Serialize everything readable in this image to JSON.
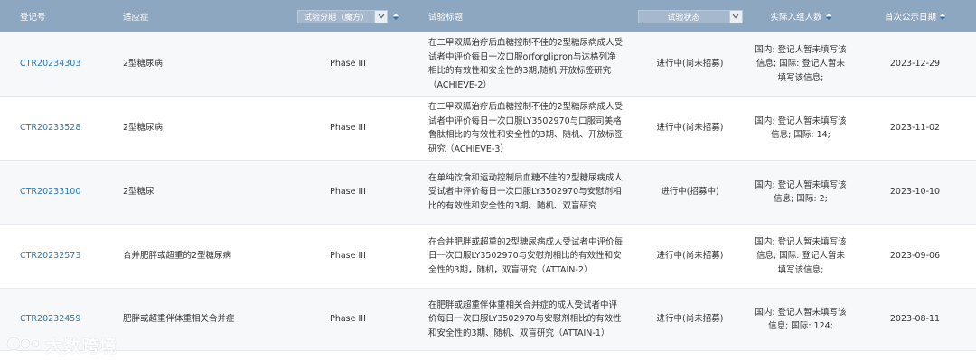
{
  "header": {
    "reg_no": "登记号",
    "indication": "适应症",
    "phase_select": "试验分期（魔方）",
    "title": "试验标题",
    "status_select": "试验状态",
    "enrolled": "实际入组人数",
    "first_pub_date": "首次公示日期"
  },
  "rows": [
    {
      "reg_no": "CTR20234303",
      "indication": "2型糖尿病",
      "phase": "Phase III",
      "title": "在二甲双胍治疗后血糖控制不佳的2型糖尿病成人受试者中评价每日一次口服orforglipron与达格列净相比的有效性和安全性的3期,随机,开放标签研究（ACHIEVE-2）",
      "status": "进行中(尚未招募)",
      "enrolled": "国内: 登记人暂未填写该信息; 国际: 登记人暂未填写该信息;",
      "date": "2023-12-29"
    },
    {
      "reg_no": "CTR20233528",
      "indication": "2型糖尿病",
      "phase": "Phase III",
      "title": "在二甲双胍治疗后血糖控制不佳的2型糖尿病成人受试者中评价每日一次口服LY3502970与口服司美格鲁肽相比的有效性和安全性的3期、随机、开放标签研究（ACHIEVE-3）",
      "status": "进行中(尚未招募)",
      "enrolled": "国内: 登记人暂未填写该信息; 国际: 14;",
      "date": "2023-11-02"
    },
    {
      "reg_no": "CTR20233100",
      "indication": "2型糖尿",
      "phase": "Phase III",
      "title": "在单纯饮食和运动控制后血糖不佳的2型糖尿病成人受试者中评价每日一次口服LY3502970与安慰剂相比的有效性和安全性的3期、随机、双盲研究",
      "status": "进行中(招募中)",
      "enrolled": "国内: 登记人暂未填写该信息; 国际: 2;",
      "date": "2023-10-10"
    },
    {
      "reg_no": "CTR20232573",
      "indication": "合并肥胖或超重的2型糖尿病",
      "phase": "Phase III",
      "title": "在合并肥胖或超重的2型糖尿病成人受试者中评价每日一次口服LY3502970与安慰剂相比的有效性和安全性的3期，随机，双盲研究（ATTAIN-2）",
      "status": "进行中(尚未招募)",
      "enrolled": "国内: 登记人暂未填写该信息; 国际: 登记人暂未填写该信息;",
      "date": "2023-09-06"
    },
    {
      "reg_no": "CTR20232459",
      "indication": "肥胖或超重伴体重相关合并症",
      "phase": "Phase III",
      "title": "在肥胖或超重伴体重相关合并症的成人受试者中评价每日一次口服LY3502970与安慰剂相比的有效性和安全性的3期、随机、双盲研究（ATTAIN-1）",
      "status": "进行中(尚未招募)",
      "enrolled": "国内: 登记人暂未填写该信息; 国际: 124;",
      "date": "2023-08-11"
    }
  ],
  "watermark": "大数跨境",
  "icons": {
    "dropdown": "chevron-down-icon",
    "sort": "sort-icon",
    "logo": "watermark-logo-icon"
  },
  "colors": {
    "header_bg": "#8ea7c0",
    "link": "#2a79b8",
    "row_alt": "#f7f8fa"
  }
}
